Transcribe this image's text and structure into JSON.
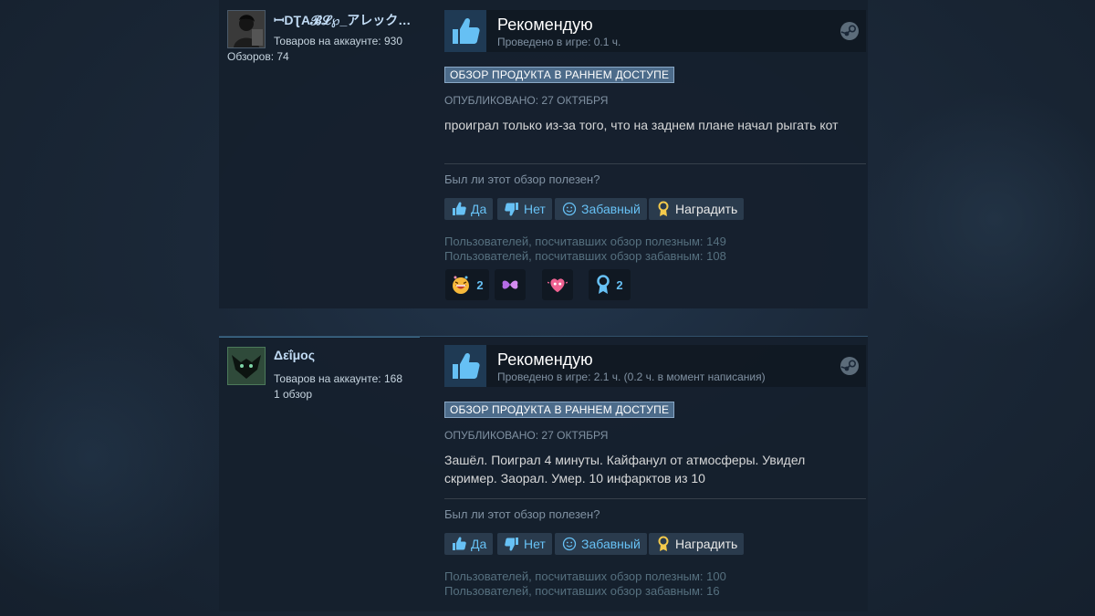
{
  "colors": {
    "page_bg": "#1b2838",
    "panel_bg": "#16202d",
    "link_blue": "#67c1f5",
    "thumb_up": "#66c0f4",
    "award_gold": "#f2c94c"
  },
  "reviews": [
    {
      "author": {
        "name": "ꟷDƮA𝓑𝓛℘_アレック…",
        "products_label": "Товаров на аккаунте: 930",
        "reviews_label": "Обзоров: 74"
      },
      "recommend": "Рекомендую",
      "hours": "Проведено в игре: 0.1 ч.",
      "badge": "ОБЗОР ПРОДУКТА В РАННЕМ ДОСТУПЕ",
      "posted": "ОПУБЛИКОВАНО: 27 ОКТЯБРЯ",
      "text": "проиграл только из-за того, что на заднем плане начал рыгать кот",
      "helpful_question": "Был ли этот обзор полезен?",
      "buttons": {
        "yes": "Да",
        "no": "Нет",
        "funny": "Забавный",
        "award": "Наградить"
      },
      "helpful_stat": "Пользователей, посчитавших обзор полезным: 149",
      "funny_stat": "Пользователей, посчитавших обзор забавным: 108",
      "awards": [
        {
          "icon": "laughing-face-icon",
          "count": "2"
        },
        {
          "icon": "butterfly-icon",
          "count": ""
        },
        {
          "icon": "heart-eyes-icon",
          "count": ""
        },
        {
          "icon": "ribbon-medal-icon",
          "count": "2"
        }
      ]
    },
    {
      "author": {
        "name": "Δεΐμος",
        "products_label": "Товаров на аккаунте: 168",
        "reviews_label": "1 обзор"
      },
      "recommend": "Рекомендую",
      "hours": "Проведено в игре: 2.1 ч. (0.2 ч. в момент написания)",
      "badge": "ОБЗОР ПРОДУКТА В РАННЕМ ДОСТУПЕ",
      "posted": "ОПУБЛИКОВАНО: 27 ОКТЯБРЯ",
      "text": "Зашёл. Поиграл 4 минуты. Кайфанул от атмосферы. Увидел скример. Заорал. Умер. 10 инфарктов из 10",
      "helpful_question": "Был ли этот обзор полезен?",
      "buttons": {
        "yes": "Да",
        "no": "Нет",
        "funny": "Забавный",
        "award": "Наградить"
      },
      "helpful_stat": "Пользователей, посчитавших обзор полезным: 100",
      "funny_stat": "Пользователей, посчитавших обзор забавным: 16"
    }
  ]
}
